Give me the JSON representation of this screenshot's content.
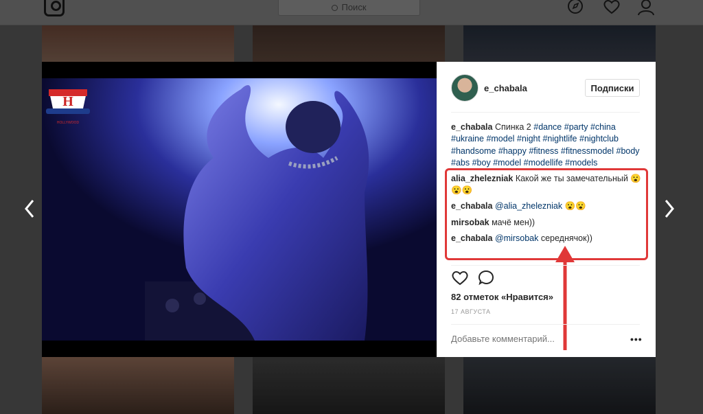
{
  "nav": {
    "search_placeholder": "Поиск",
    "icons": [
      "instagram-logo-icon",
      "search-icon",
      "compass-icon",
      "heart-icon",
      "profile-icon"
    ]
  },
  "post": {
    "username": "e_chabala",
    "follow_label": "Подписки",
    "caption": {
      "user": "e_chabala",
      "text": "Спинка 2",
      "hashtags": [
        "#dance",
        "#party",
        "#china",
        "#ukraine",
        "#model",
        "#night",
        "#nightlife",
        "#nightclub",
        "#handsome",
        "#happy",
        "#fitness",
        "#fitnessmodel",
        "#body",
        "#abs",
        "#boy",
        "#model",
        "#modellife",
        "#models"
      ]
    },
    "comments": [
      {
        "user": "alia_zhelezniak",
        "mention": "",
        "text": "Какой же ты замечательный 😮😮😮"
      },
      {
        "user": "e_chabala",
        "mention": "@alia_zhelezniak",
        "text": "😮😮"
      },
      {
        "user": "mirsobak",
        "mention": "",
        "text": "мачё мен))"
      },
      {
        "user": "e_chabala",
        "mention": "@mirsobak",
        "text": "середнячок))"
      }
    ],
    "likes": "82 отметок «Нравится»",
    "date": "17 АВГУСТА",
    "add_comment_placeholder": "Добавьте комментарий...",
    "more_label": "•••",
    "actions": [
      "like-icon",
      "comment-icon"
    ]
  },
  "photo_logo_text": "HOLLYWOOD",
  "colors": {
    "highlight": "#e03838",
    "hashtag": "#003569",
    "text": "#262626"
  }
}
